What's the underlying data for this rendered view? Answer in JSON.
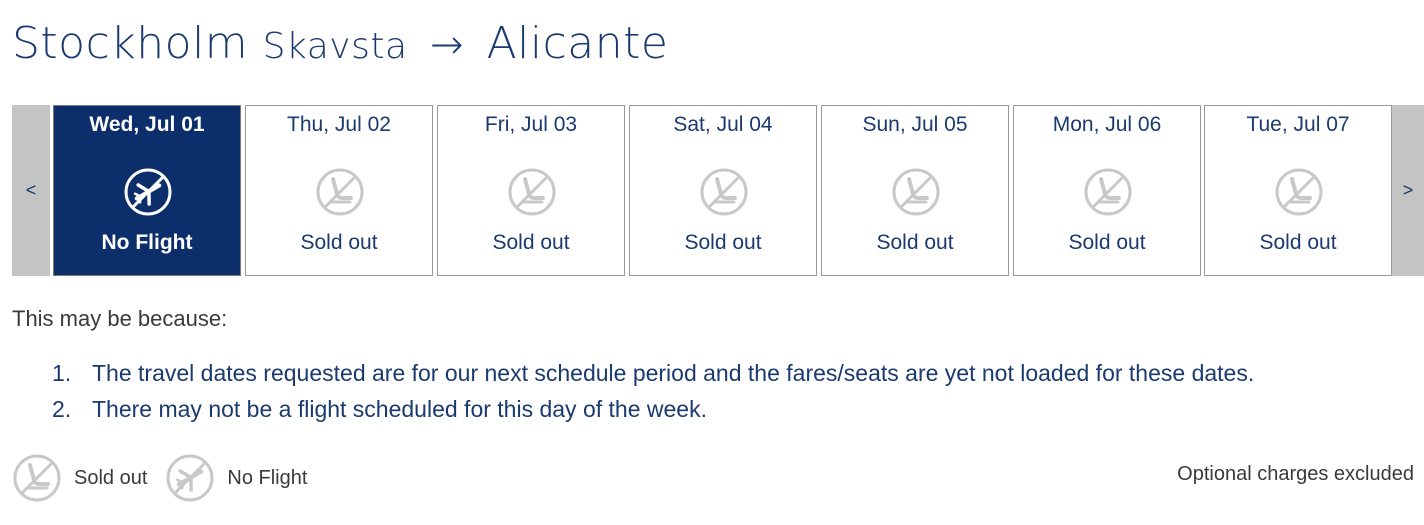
{
  "route": {
    "origin": "Stockholm",
    "origin_airport": "Skavsta",
    "arrow": "→",
    "destination": "Alicante"
  },
  "date_nav": {
    "prev_label": "<",
    "next_label": ">"
  },
  "days": [
    {
      "date": "Wed, Jul 01",
      "status": "No Flight",
      "icon": "no-flight-icon",
      "selected": true
    },
    {
      "date": "Thu, Jul 02",
      "status": "Sold out",
      "icon": "sold-out-seat-icon",
      "selected": false
    },
    {
      "date": "Fri, Jul 03",
      "status": "Sold out",
      "icon": "sold-out-seat-icon",
      "selected": false
    },
    {
      "date": "Sat, Jul 04",
      "status": "Sold out",
      "icon": "sold-out-seat-icon",
      "selected": false
    },
    {
      "date": "Sun, Jul 05",
      "status": "Sold out",
      "icon": "sold-out-seat-icon",
      "selected": false
    },
    {
      "date": "Mon, Jul 06",
      "status": "Sold out",
      "icon": "sold-out-seat-icon",
      "selected": false
    },
    {
      "date": "Tue, Jul 07",
      "status": "Sold out",
      "icon": "sold-out-seat-icon",
      "selected": false
    }
  ],
  "reasons": {
    "intro": "This may be because:",
    "items": [
      {
        "number": "1.",
        "text": "The travel dates requested are for our next schedule period and the fares/seats are yet not loaded for these dates."
      },
      {
        "number": "2.",
        "text": "There may not be a flight scheduled for this day of the week."
      }
    ]
  },
  "legend": {
    "sold_out_label": "Sold out",
    "no_flight_label": "No Flight"
  },
  "optional_note": "Optional charges excluded",
  "colors": {
    "brand_navy": "#0c2e6b",
    "title_blue": "#1b3a6e",
    "nav_gray": "#c4c4c4",
    "icon_gray": "#c8c8c8",
    "border_gray": "#9a9a9a"
  }
}
